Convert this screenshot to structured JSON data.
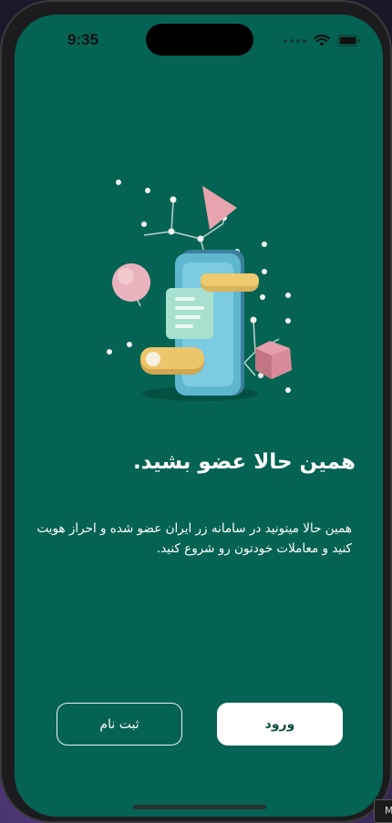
{
  "status_bar": {
    "time": "9:35"
  },
  "onboarding": {
    "title": "همین حالا عضو بشید.",
    "description": "همین حالا میتونید در سامانه زر ایران عضو شده و احراز هویت کنید و معاملات خودتون رو شروع کنید."
  },
  "actions": {
    "login_label": "ورود",
    "signup_label": "ثبت نام"
  },
  "corner_tag": "M",
  "colors": {
    "screen_bg": "#056353",
    "primary_button_bg": "#ffffff",
    "primary_button_text": "#0b4d42",
    "outline_border": "#e8f3f0"
  },
  "icons": [
    "wifi-icon",
    "battery-icon",
    "onboarding-illustration"
  ]
}
